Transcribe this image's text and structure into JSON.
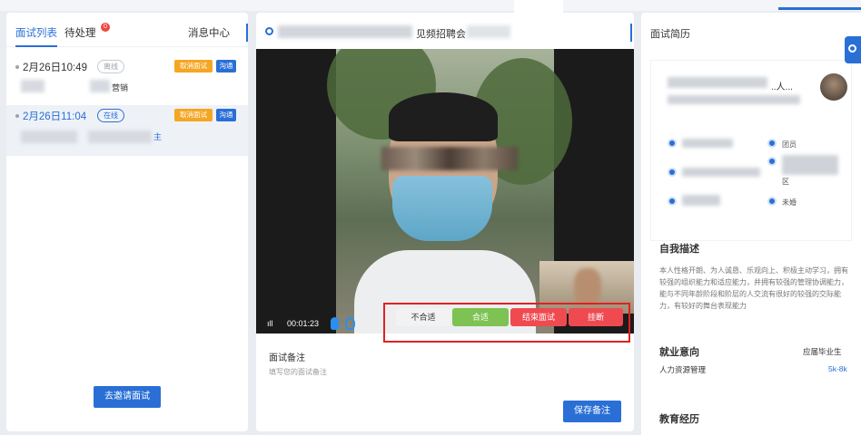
{
  "left_panel": {
    "tabs": [
      {
        "label": "面试列表"
      },
      {
        "label": "待处理"
      },
      {
        "label": "消息中心"
      }
    ],
    "pending_badge": "0",
    "items": [
      {
        "time": "2月26日10:49",
        "state": "离线",
        "cancel": "取消面试",
        "chat": "沟通",
        "tail": "营销"
      },
      {
        "time": "2月26日11:04",
        "state": "在线",
        "cancel": "取消面试",
        "chat": "沟通",
        "tail": "主"
      }
    ],
    "invite_button": "去邀请面试"
  },
  "middle_panel": {
    "title_suffix": "见频招聘会",
    "video": {
      "signal": "ıll",
      "elapsed": "00:01:23"
    },
    "controls": {
      "unfit": "不合适",
      "fit": "合适",
      "end": "结束面试",
      "hangup": "挂断"
    },
    "note_title": "面试备注",
    "note_placeholder": "填写您的面试备注",
    "save_button": "保存备注"
  },
  "right_panel": {
    "header": "面试简历",
    "name_suffix": "..人...",
    "info": {
      "party": "团员",
      "district": "区",
      "marital": "未婚"
    },
    "self_desc_title": "自我描述",
    "self_desc": "本人性格开朗、为人诚恳、乐观向上、积极主动学习，拥有较强的组织能力和适应能力，并拥有较强的管理协调能力，能与不同年龄阶段和阶层的人交流有很好的较强的交际能力，有较好的舞台表现能力",
    "job_title": "就业意向",
    "job_type": "应届毕业生",
    "job_role": "人力资源管理",
    "salary": "5k-8k",
    "edu_title": "教育经历"
  },
  "colors": {
    "accent": "#2a6fd6",
    "fit": "#7dc252",
    "danger": "#ef4a50",
    "warn": "#f5a623"
  }
}
